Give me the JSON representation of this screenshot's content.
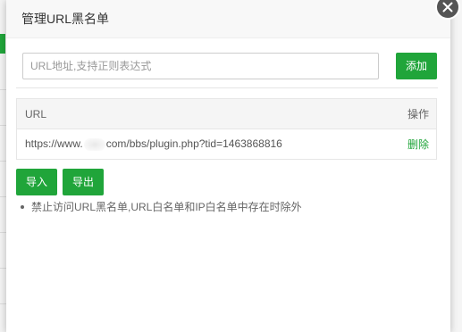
{
  "dialog": {
    "title": "管理URL黑名单",
    "input_placeholder": "URL地址,支持正则表达式",
    "add_label": "添加",
    "table": {
      "columns": [
        "URL",
        "操作"
      ],
      "rows": [
        {
          "url_prefix": "https://www.",
          "url_suffix": "com/bbs/plugin.php?tid=1463868816",
          "action": "删除"
        }
      ]
    },
    "import_label": "导入",
    "export_label": "导出",
    "notes": [
      "禁止访问URL黑名单,URL白名单和IP白名单中存在时除外"
    ]
  },
  "colors": {
    "accent": "#20a53a",
    "close_bg": "#555555"
  },
  "icons": {
    "close": "close-icon"
  }
}
